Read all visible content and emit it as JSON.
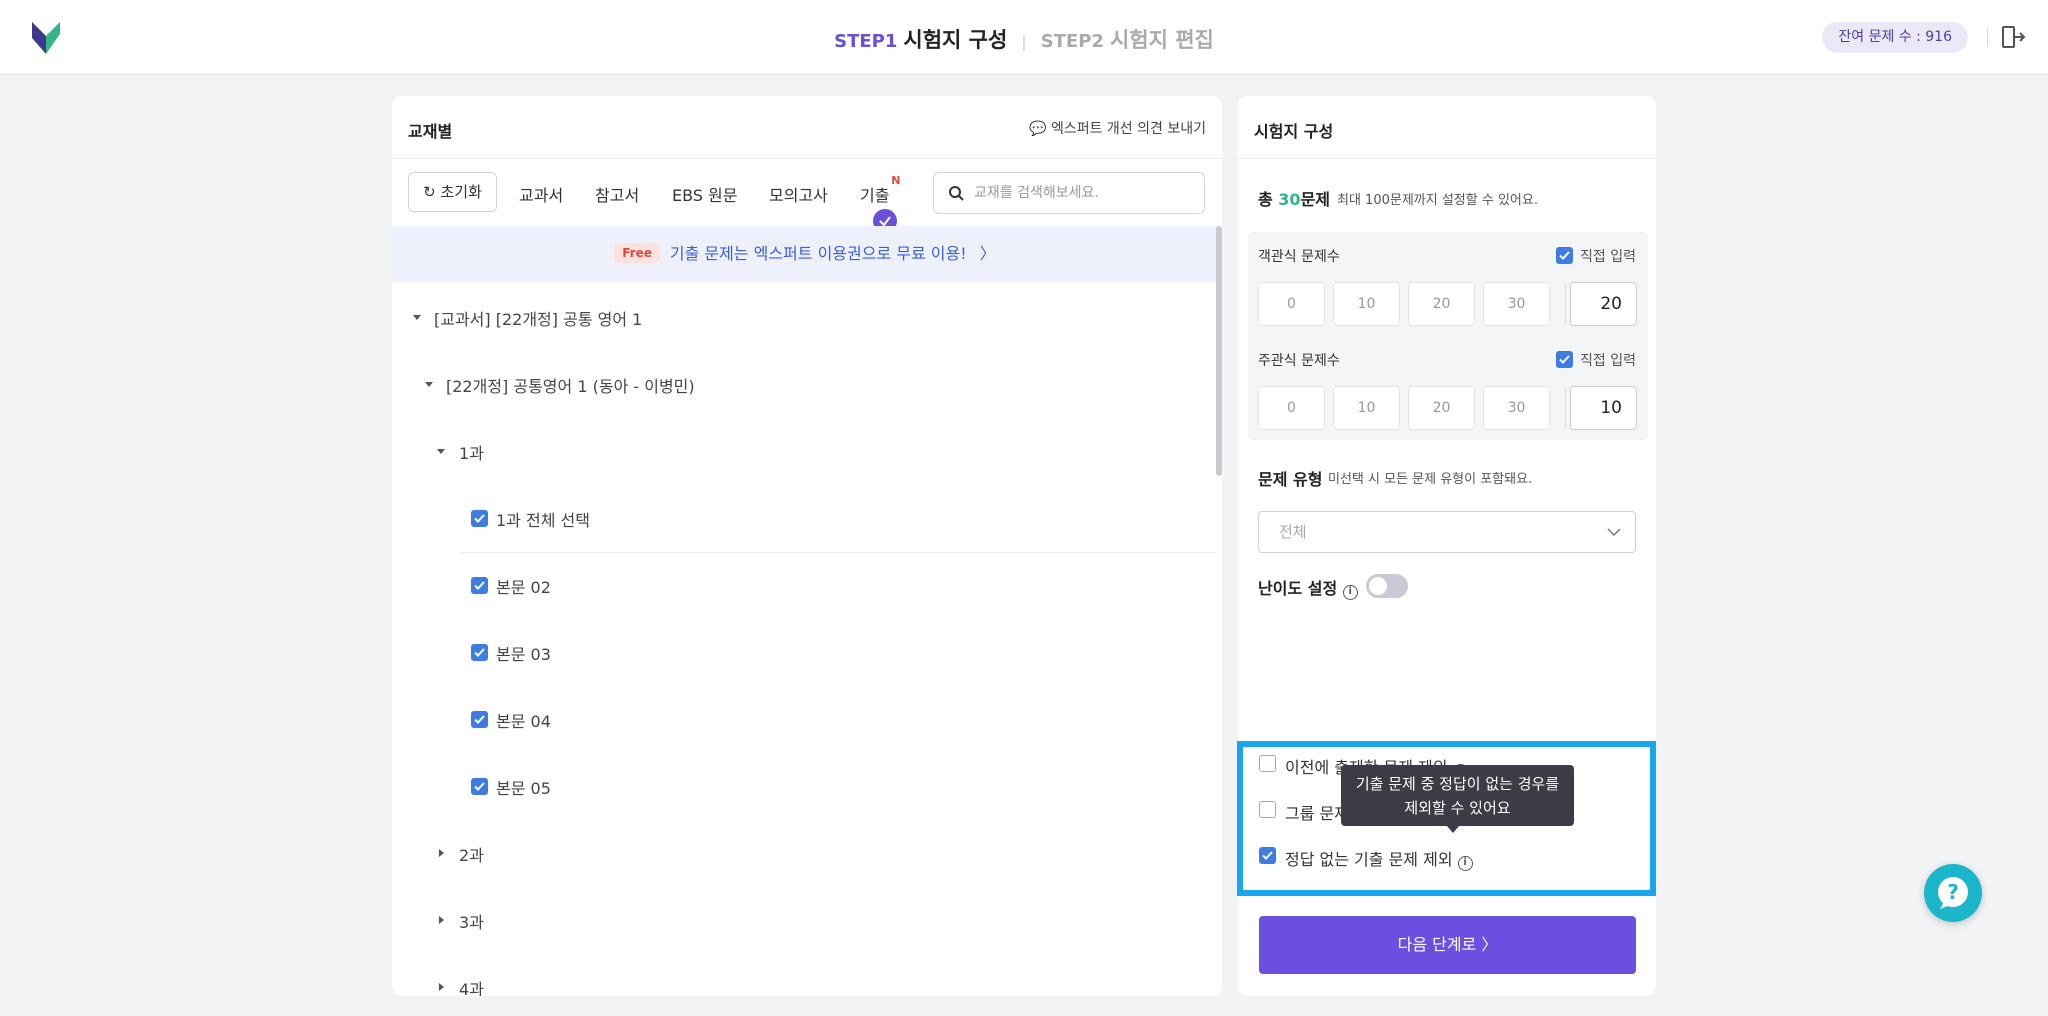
{
  "header": {
    "step1_key": "STEP1",
    "step1_title": "시험지 구성",
    "step2_key": "STEP2",
    "step2_title": "시험지 편집",
    "remaining": "잔여 문제 수 : 916"
  },
  "left": {
    "title": "교재별",
    "feedback": "💬 엑스퍼트 개선 의견 보내기",
    "reset_label": "초기화",
    "tabs": [
      "교과서",
      "참고서",
      "EBS 원문",
      "모의고사",
      "기출"
    ],
    "tab_new_badge": "N",
    "search_placeholder": "교재를 검색해보세요.",
    "promo_badge": "Free",
    "promo_text": "기출 문제는 엑스퍼트 이용권으로 무료 이용!",
    "promo_arrow": "〉",
    "tree": {
      "root": "[교과서] [22개정] 공통 영어 1",
      "book": "[22개정] 공통영어 1 (동아 - 이병민)",
      "lesson1": "1과",
      "lesson1_all": "1과 전체 선택",
      "items": [
        "본문 02",
        "본문 03",
        "본문 04",
        "본문 05"
      ],
      "lesson2": "2과",
      "lesson3": "3과",
      "lesson4": "4과"
    }
  },
  "right": {
    "title": "시험지 구성",
    "total_prefix": "총 ",
    "total_num": "30",
    "total_suffix": "문제",
    "total_note": "최대 100문제까지 설정할 수 있어요.",
    "objective_label": "객관식 문제수",
    "subjective_label": "주관식 문제수",
    "direct_input": "직접 입력",
    "options": [
      "0",
      "10",
      "20",
      "30"
    ],
    "objective_value": "20",
    "subjective_value": "10",
    "type_title": "문제 유형",
    "type_note": "미선택 시 모든 문제 유형이 포함돼요.",
    "type_value": "전체",
    "difficulty_label": "난이도 설정",
    "difficulty_on": false,
    "excludes": [
      {
        "label": "이전에 출제한 문제 제외",
        "checked": false
      },
      {
        "label": "그룹 문제",
        "checked": false
      },
      {
        "label": "정답 없는 기출 문제 제외",
        "checked": true
      }
    ],
    "tooltip_line1": "기출 문제 중 정답이 없는 경우를",
    "tooltip_line2": "제외할 수 있어요",
    "next_label": "다음 단계로 〉"
  },
  "colors": {
    "accent": "#6b4fe0",
    "check": "#3d7ce0",
    "highlight": "#19a6ef",
    "chat": "#1bb6c9"
  }
}
